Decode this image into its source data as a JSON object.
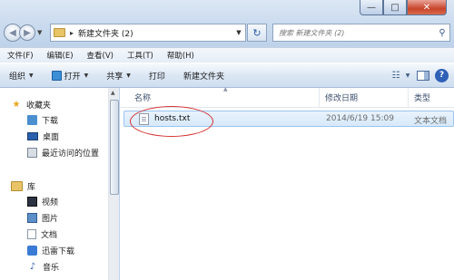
{
  "window": {
    "controls": {
      "minimize": "—",
      "maximize": "□",
      "close": "✕"
    }
  },
  "address": {
    "path": "新建文件夹 (2)",
    "search_placeholder": "搜索 新建文件夹 (2)"
  },
  "menu": [
    "文件(F)",
    "编辑(E)",
    "查看(V)",
    "工具(T)",
    "帮助(H)"
  ],
  "commands": {
    "organize": "组织",
    "open": "打开",
    "share": "共享",
    "print": "打印",
    "new_folder": "新建文件夹"
  },
  "nav": {
    "favorites": "收藏夹",
    "downloads": "下载",
    "desktop": "桌面",
    "recent": "最近访问的位置",
    "libraries": "库",
    "videos": "视频",
    "pictures": "图片",
    "documents": "文档",
    "thunder": "迅雷下载",
    "music": "音乐"
  },
  "columns": {
    "name": "名称",
    "modified": "修改日期",
    "type": "类型"
  },
  "files": [
    {
      "name": "hosts.txt",
      "modified": "2014/6/19 15:09",
      "type": "文本文档"
    }
  ],
  "icons": {
    "back": "back-arrow-icon",
    "forward": "forward-arrow-icon",
    "refresh": "refresh-icon",
    "search": "search-icon",
    "help": "help-icon"
  }
}
